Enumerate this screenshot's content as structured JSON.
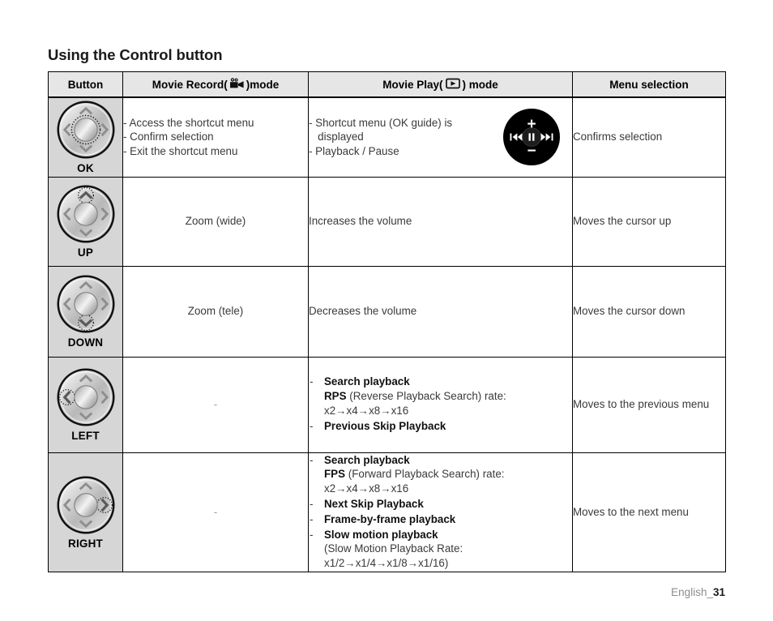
{
  "page": {
    "title": "Using the Control button",
    "footer_label": "English_",
    "footer_page": "31"
  },
  "table": {
    "headers": {
      "button": "Button",
      "record_prefix": "Movie Record(",
      "record_suffix": ")mode",
      "record_icon": "movie-camera-icon",
      "play_prefix": "Movie Play(",
      "play_suffix": ") mode",
      "play_icon": "play-box-icon",
      "menu": "Menu selection"
    },
    "rows": [
      {
        "button_label": "OK",
        "dial_highlight": "center",
        "record": {
          "type": "lines",
          "lines": [
            "- Access the shortcut menu",
            "- Confirm selection",
            "- Exit the shortcut menu"
          ]
        },
        "play": {
          "type": "lines",
          "lines": [
            "- Shortcut menu (OK guide) is",
            "   displayed",
            "- Playback / Pause"
          ],
          "icon": "playback-control-circle-icon"
        },
        "menu": "Confirms selection"
      },
      {
        "button_label": "UP",
        "dial_highlight": "up",
        "record": {
          "type": "center",
          "text": "Zoom (wide)"
        },
        "play": {
          "type": "plain",
          "text": "Increases the volume"
        },
        "menu": "Moves the cursor up"
      },
      {
        "button_label": "DOWN",
        "dial_highlight": "down",
        "record": {
          "type": "center",
          "text": "Zoom (tele)"
        },
        "play": {
          "type": "plain",
          "text": "Decreases the volume"
        },
        "menu": "Moves the cursor down"
      },
      {
        "button_label": "LEFT",
        "dial_highlight": "left",
        "record": {
          "type": "center",
          "text": "-"
        },
        "play": {
          "type": "list",
          "items": [
            {
              "bold": "Search playback",
              "sub": [
                {
                  "bold": "RPS",
                  "rest": " (Reverse Playback Search) rate:"
                },
                {
                  "rest": "x2→x4→x8→x16"
                }
              ]
            },
            {
              "bold": "Previous Skip Playback"
            }
          ]
        },
        "menu": "Moves to the previous menu"
      },
      {
        "button_label": "RIGHT",
        "dial_highlight": "right",
        "record": {
          "type": "center",
          "text": "-"
        },
        "play": {
          "type": "list",
          "items": [
            {
              "bold": "Search playback",
              "sub": [
                {
                  "bold": "FPS",
                  "rest": " (Forward Playback Search) rate:"
                },
                {
                  "rest": "x2→x4→x8→x16"
                }
              ]
            },
            {
              "bold": "Next Skip Playback"
            },
            {
              "bold": "Frame-by-frame playback"
            },
            {
              "bold": "Slow motion playback",
              "sub": [
                {
                  "rest": "(Slow Motion Playback Rate:"
                },
                {
                  "rest": "x1/2→x1/4→x1/8→x1/16)"
                }
              ]
            }
          ]
        },
        "menu": "Moves to the next menu"
      }
    ]
  },
  "playback_icon": {
    "plus": "+",
    "minus": "−",
    "prev": "skip-backward-icon",
    "next": "skip-forward-icon",
    "center": "pause-icon"
  },
  "colors": {
    "header_bg": "#e6e6e6",
    "button_col_bg": "#d6d6d6",
    "border": "#000000",
    "text": "#3a3a3a",
    "footer_gray": "#8c8c8c"
  }
}
